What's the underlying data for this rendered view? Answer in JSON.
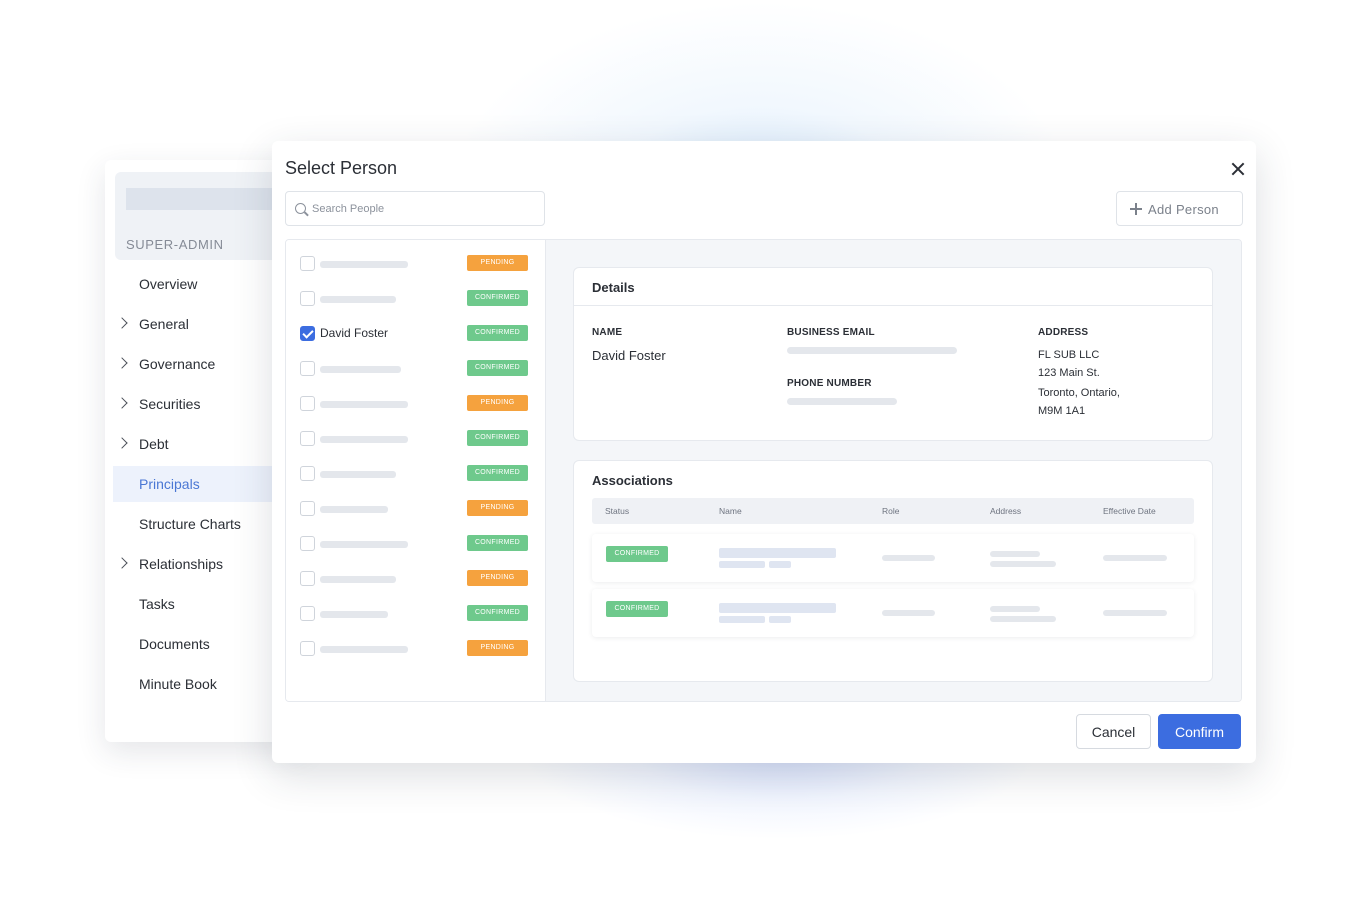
{
  "sidebar": {
    "role": "SUPER-ADMIN",
    "items": [
      {
        "label": "Overview"
      },
      {
        "label": "General"
      },
      {
        "label": "Governance"
      },
      {
        "label": "Securities"
      },
      {
        "label": "Debt"
      },
      {
        "label": "Principals"
      },
      {
        "label": "Structure Charts"
      },
      {
        "label": "Relationships"
      },
      {
        "label": "Tasks"
      },
      {
        "label": "Documents"
      },
      {
        "label": "Minute Book"
      }
    ]
  },
  "modal": {
    "title": "Select Person",
    "search_placeholder": "Search People",
    "add_person_label": "Add  Person",
    "people": [
      {
        "name": "",
        "status": "PENDING",
        "checked": false
      },
      {
        "name": "",
        "status": "CONFIRMED",
        "checked": false
      },
      {
        "name": "David Foster",
        "status": "CONFIRMED",
        "checked": true
      },
      {
        "name": "",
        "status": "CONFIRMED",
        "checked": false
      },
      {
        "name": "",
        "status": "PENDING",
        "checked": false
      },
      {
        "name": "",
        "status": "CONFIRMED",
        "checked": false
      },
      {
        "name": "",
        "status": "CONFIRMED",
        "checked": false
      },
      {
        "name": "",
        "status": "PENDING",
        "checked": false
      },
      {
        "name": "",
        "status": "CONFIRMED",
        "checked": false
      },
      {
        "name": "",
        "status": "PENDING",
        "checked": false
      },
      {
        "name": "",
        "status": "CONFIRMED",
        "checked": false
      },
      {
        "name": "",
        "status": "PENDING",
        "checked": false
      }
    ],
    "details": {
      "title": "Details",
      "name_label": "NAME",
      "name_value": "David Foster",
      "email_label": "BUSINESS EMAIL",
      "phone_label": "PHONE NUMBER",
      "address_label": "ADDRESS",
      "address_lines": [
        "FL SUB LLC",
        "123 Main St.",
        "Toronto, Ontario,",
        "M9M 1A1"
      ]
    },
    "associations": {
      "title": "Associations",
      "columns": [
        "Status",
        "Name",
        "Role",
        "Address",
        "Effective Date"
      ],
      "rows": [
        {
          "status": "CONFIRMED"
        },
        {
          "status": "CONFIRMED"
        }
      ]
    },
    "cancel_label": "Cancel",
    "confirm_label": "Confirm"
  },
  "colors": {
    "accent": "#3c6de0",
    "pending": "#f5a23e",
    "confirmed": "#6ec98c",
    "active_nav_text": "#4a77d4"
  }
}
